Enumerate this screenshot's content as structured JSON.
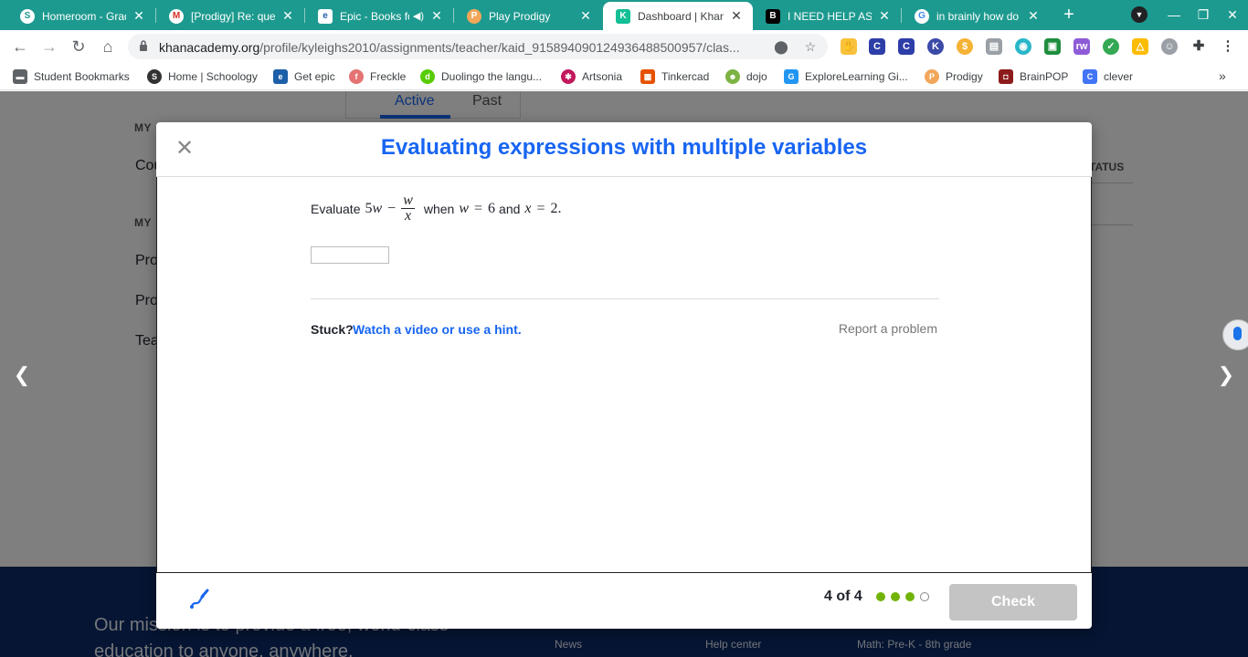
{
  "browser": {
    "tabs": [
      {
        "title": "Homeroom - Grad",
        "icon": "schoology-s-icon",
        "active": false
      },
      {
        "title": "[Prodigy] Re: quest",
        "icon": "gmail-icon",
        "active": false
      },
      {
        "title": "Epic - Books fo",
        "icon": "epic-icon",
        "active": false
      },
      {
        "title": "Play Prodigy",
        "icon": "prodigy-icon",
        "active": false
      },
      {
        "title": "Dashboard | Khan",
        "icon": "khan-academy-icon",
        "active": true
      },
      {
        "title": "I NEED HELP ASA",
        "icon": "brainly-icon",
        "active": false
      },
      {
        "title": "in brainly how do",
        "icon": "google-icon",
        "active": false
      }
    ],
    "new_tab_label": "+",
    "url_domain": "khanacademy.org",
    "url_path": "/profile/kyleighs2010/assignments/teacher/kaid_915894090124936488500957/clas...",
    "bookmarks": [
      {
        "label": "Student Bookmarks",
        "icon": "folder-icon"
      },
      {
        "label": "Home | Schoology",
        "icon": "schoology-s-icon"
      },
      {
        "label": "Get epic",
        "icon": "epic-icon"
      },
      {
        "label": "Freckle",
        "icon": "freckle-icon"
      },
      {
        "label": "Duolingo the langu...",
        "icon": "duolingo-icon"
      },
      {
        "label": "Artsonia",
        "icon": "artsonia-icon"
      },
      {
        "label": "Tinkercad",
        "icon": "tinkercad-icon"
      },
      {
        "label": "dojo",
        "icon": "classdojo-icon"
      },
      {
        "label": "ExploreLearning Gi...",
        "icon": "explorelearning-icon"
      },
      {
        "label": "Prodigy",
        "icon": "prodigy-icon"
      },
      {
        "label": "BrainPOP",
        "icon": "brainpop-icon"
      },
      {
        "label": "clever",
        "icon": "clever-icon"
      }
    ]
  },
  "background_page": {
    "section_my_1": "MY",
    "section_my_2": "MY",
    "side_links": [
      "Cou",
      "Pro",
      "Pro",
      "Tea"
    ],
    "tabs": [
      "Active",
      "Past"
    ],
    "status_header": "TATUS",
    "mission": "Our mission is to provide a free, world-class education to anyone, anywhere.",
    "footer_links": [
      "News",
      "Help center",
      "Math: Pre-K - 8th grade"
    ]
  },
  "modal": {
    "title": "Evaluating expressions with multiple variables",
    "question": {
      "prefix": "Evaluate",
      "expr_coeff": "5",
      "expr_var": "w",
      "expr_minus": "−",
      "frac_num": "w",
      "frac_den": "x",
      "when_word": "when",
      "cond1_var": "w",
      "cond1_eq": "=",
      "cond1_val": "6",
      "and_word": "and",
      "cond2_var": "x",
      "cond2_eq": "=",
      "cond2_val": "2",
      "end_period": "."
    },
    "answer_value": "",
    "stuck_label": "Stuck?",
    "hint_link": "Watch a video or use a hint.",
    "report_link": "Report a problem",
    "progress_text": "4 of 4",
    "progress": {
      "completed": 3,
      "total": 4
    },
    "check_label": "Check"
  },
  "colors": {
    "tabstrip": "#1d9a8f",
    "khan_blue": "#1865f2",
    "progress_green": "#71b307",
    "check_disabled": "#c4c4c4",
    "footer_navy": "#0a2a66"
  }
}
